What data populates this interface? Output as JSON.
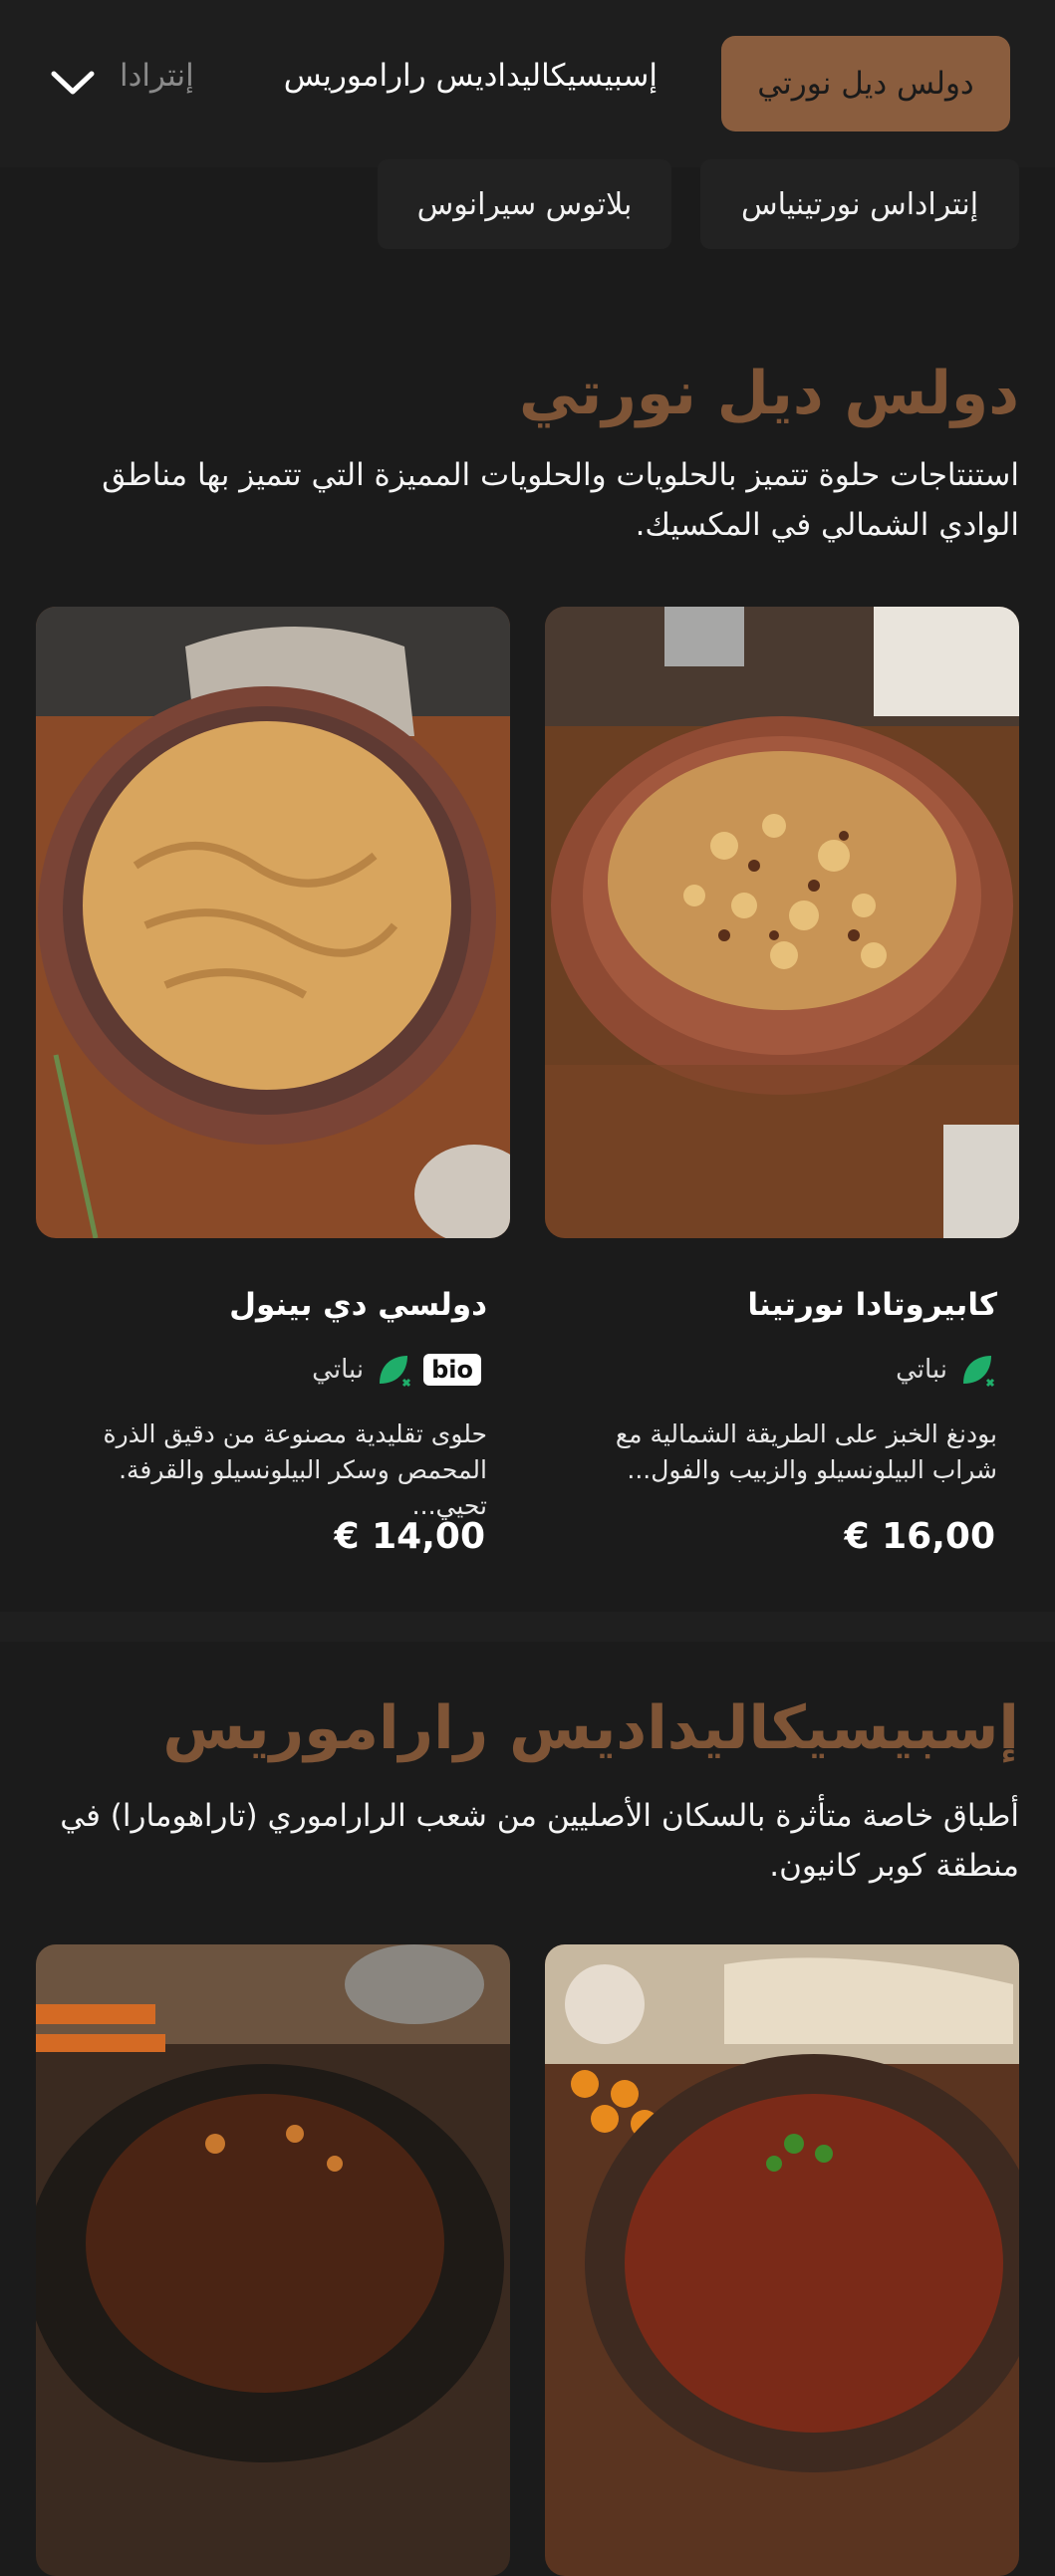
{
  "nav": {
    "active_tab": "دولس ديل نورتي",
    "tab2": "إسبيسيكاليداديس راراموريس",
    "tab3": "إنترادا",
    "sub_tabs": [
      "إنتراداس نورتينياس",
      "بلاتوس سيرانوس"
    ]
  },
  "sections": [
    {
      "title": "دولس ديل نورتي",
      "description": "استنتاجات حلوة تتميز بالحلويات والحلويات المميزة التي تتميز بها مناطق الوادي الشمالي في المكسيك.",
      "items": [
        {
          "name": "كابيروتادا نورتينا",
          "tag": "نباتي",
          "description": "بودنغ الخبز على الطريقة الشمالية مع شراب البيلونسيلو والزبيب والفول...",
          "price": "16,00 €"
        },
        {
          "name": "دولسي دي بينول",
          "tag": "نباتي",
          "badge": "bio",
          "description": "حلوى تقليدية مصنوعة من دقيق الذرة المحمص وسكر البيلونسيلو والقرفة. تحيي...",
          "price": "14,00 €"
        }
      ]
    },
    {
      "title": "إسبيسيكاليداديس راراموريس",
      "description": "أطباق خاصة متأثرة بالسكان الأصليين من شعب الراراموري (تاراهومارا) في منطقة كوبر كانيون."
    }
  ],
  "colors": {
    "background": "#1b1b1b",
    "accent": "#8a5d3e",
    "section_title": "#7e5436",
    "vegan_icon": "#1fae6a"
  },
  "icons": {
    "dropdown": "chevron-down-icon",
    "vegan": "leaf-icon"
  }
}
